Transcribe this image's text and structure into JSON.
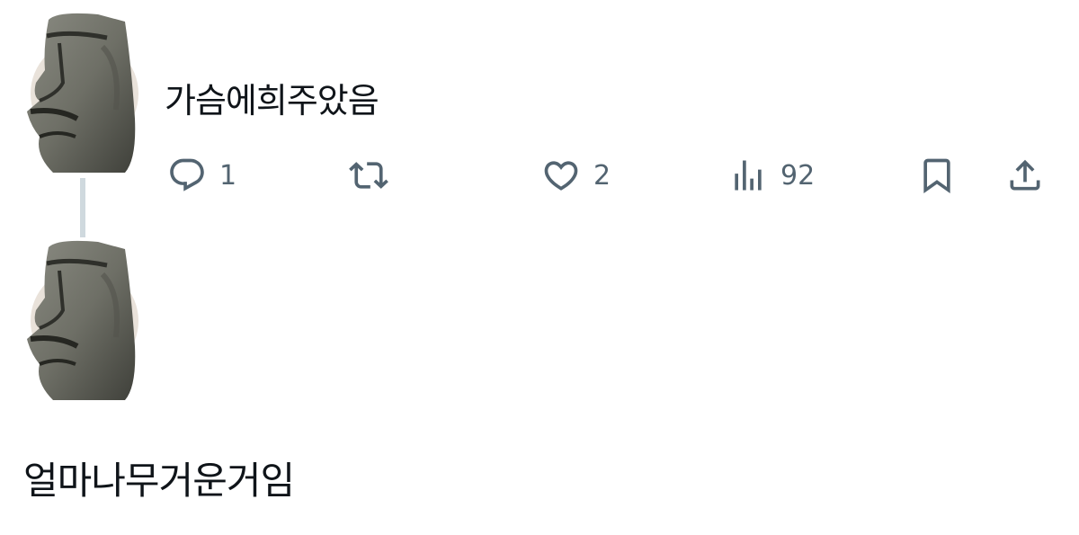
{
  "tweet": {
    "text": "가슴에희주았음",
    "actions": {
      "reply_count": "1",
      "like_count": "2",
      "views_count": "92"
    },
    "icons": [
      "reply-icon",
      "retweet-icon",
      "like-icon",
      "views-icon",
      "bookmark-icon",
      "share-icon"
    ]
  },
  "reply": {
    "text": "얼마나무거운거임"
  },
  "colors": {
    "text_primary": "#0f1419",
    "text_secondary": "#536471",
    "thread_line": "#cfd9de",
    "background": "#ffffff"
  }
}
